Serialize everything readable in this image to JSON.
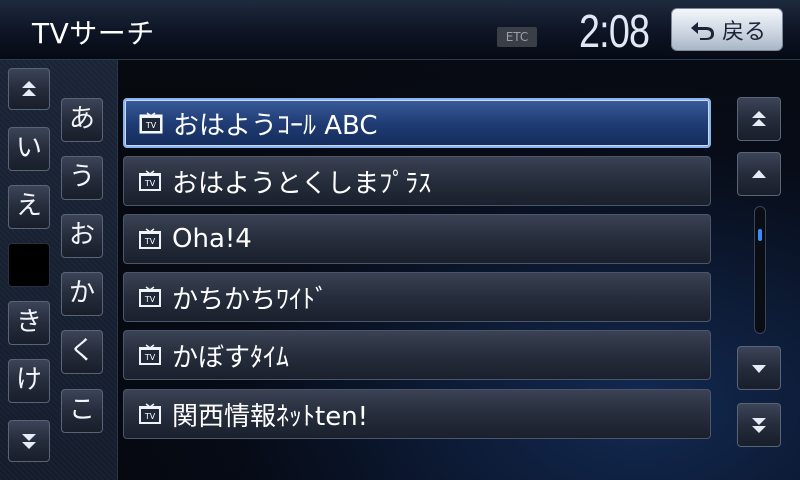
{
  "header": {
    "title": "TVサーチ",
    "etc_label": "ETC",
    "clock": "2:08",
    "back_label": "戻る"
  },
  "kana_keys": {
    "col1": [
      "い",
      "え",
      "",
      "き",
      "け"
    ],
    "col2": [
      "あ",
      "う",
      "お",
      "か",
      "く",
      "こ"
    ]
  },
  "list": {
    "items": [
      {
        "label": "おはようｺｰﾙ ABC",
        "icon": "tv-icon",
        "selected": true
      },
      {
        "label": "おはようとくしまﾌﾟﾗｽ",
        "icon": "tv-icon",
        "selected": false
      },
      {
        "label": "Oha!4",
        "icon": "tv-icon",
        "selected": false
      },
      {
        "label": "かちかちﾜｲﾄﾞ",
        "icon": "tv-icon",
        "selected": false
      },
      {
        "label": "かぼすﾀｲﾑ",
        "icon": "tv-icon",
        "selected": false
      },
      {
        "label": "関西情報ﾈｯﾄten!",
        "icon": "tv-icon",
        "selected": false
      }
    ]
  },
  "colors": {
    "selected_border": "#8ab4f0",
    "scroll_thumb": "#3a8cff"
  }
}
